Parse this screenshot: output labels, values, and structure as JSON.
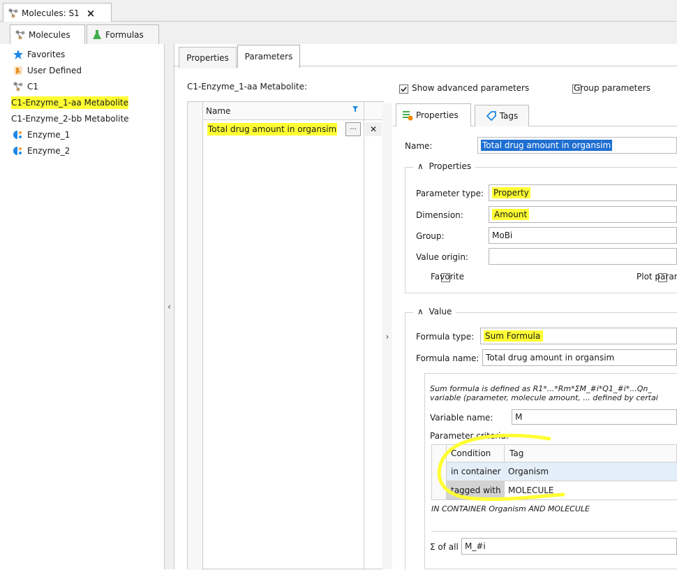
{
  "window": {
    "doc_tab_title": "Molecules: S1"
  },
  "left_tabs": [
    {
      "label": "Molecules"
    },
    {
      "label": "Formulas"
    }
  ],
  "tree": {
    "items": [
      {
        "label": "Favorites"
      },
      {
        "label": "User Defined"
      },
      {
        "label": "C1"
      },
      {
        "label": "C1-Enzyme_1-aa Metabolite"
      },
      {
        "label": "C1-Enzyme_2-bb Metabolite"
      },
      {
        "label": "Enzyme_1"
      },
      {
        "label": "Enzyme_2"
      }
    ]
  },
  "middle": {
    "tabs": [
      {
        "label": "Properties"
      },
      {
        "label": "Parameters"
      }
    ],
    "heading": "C1-Enzyme_1-aa Metabolite:",
    "grid": {
      "column_name": "Name",
      "rows": [
        {
          "name": "Total drug amount in organsim",
          "edit": "···",
          "delete": "✕"
        }
      ]
    }
  },
  "right": {
    "show_advanced_label": "Show advanced parameters",
    "show_advanced_checked": true,
    "group_params_label": "Group parameters",
    "tabs": [
      {
        "label": "Properties"
      },
      {
        "label": "Tags"
      }
    ],
    "name_label": "Name:",
    "name_value": "Total drug amount in organsim",
    "properties_group": {
      "title": "Properties",
      "parameter_type_label": "Parameter type:",
      "parameter_type_value": "Property",
      "dimension_label": "Dimension:",
      "dimension_value": "Amount",
      "group_label": "Group:",
      "group_value": "MoBi",
      "value_origin_label": "Value origin:",
      "value_origin_value": "",
      "favorite_label": "Favorite",
      "plot_label": "Plot parar"
    },
    "value_group": {
      "title": "Value",
      "formula_type_label": "Formula type:",
      "formula_type_value": "Sum Formula",
      "formula_name_label": "Formula name:",
      "formula_name_value": "Total drug amount in organsim",
      "description_line1": "Sum formula is defined as R1*...*Rm*ΣM_#i*Q1_#i*...Qn_",
      "description_line2": "variable (parameter, molecule amount, ... defined by certai",
      "variable_name_label": "Variable name:",
      "variable_name_value": "M",
      "criteria_label": "Parameter criteria:",
      "criteria_columns": [
        "Condition",
        "Tag"
      ],
      "criteria_rows": [
        {
          "condition": "in container",
          "tag": "Organism"
        },
        {
          "condition": "tagged with",
          "tag": "MOLECULE"
        }
      ],
      "criteria_summary": "IN CONTAINER Organism AND MOLECULE",
      "sum_label": "Σ of all",
      "sum_value": "M_#i"
    }
  },
  "colors": {
    "highlight": "#ffff33",
    "accent_blue": "#1e88e5",
    "selection": "#1f6fd1"
  }
}
